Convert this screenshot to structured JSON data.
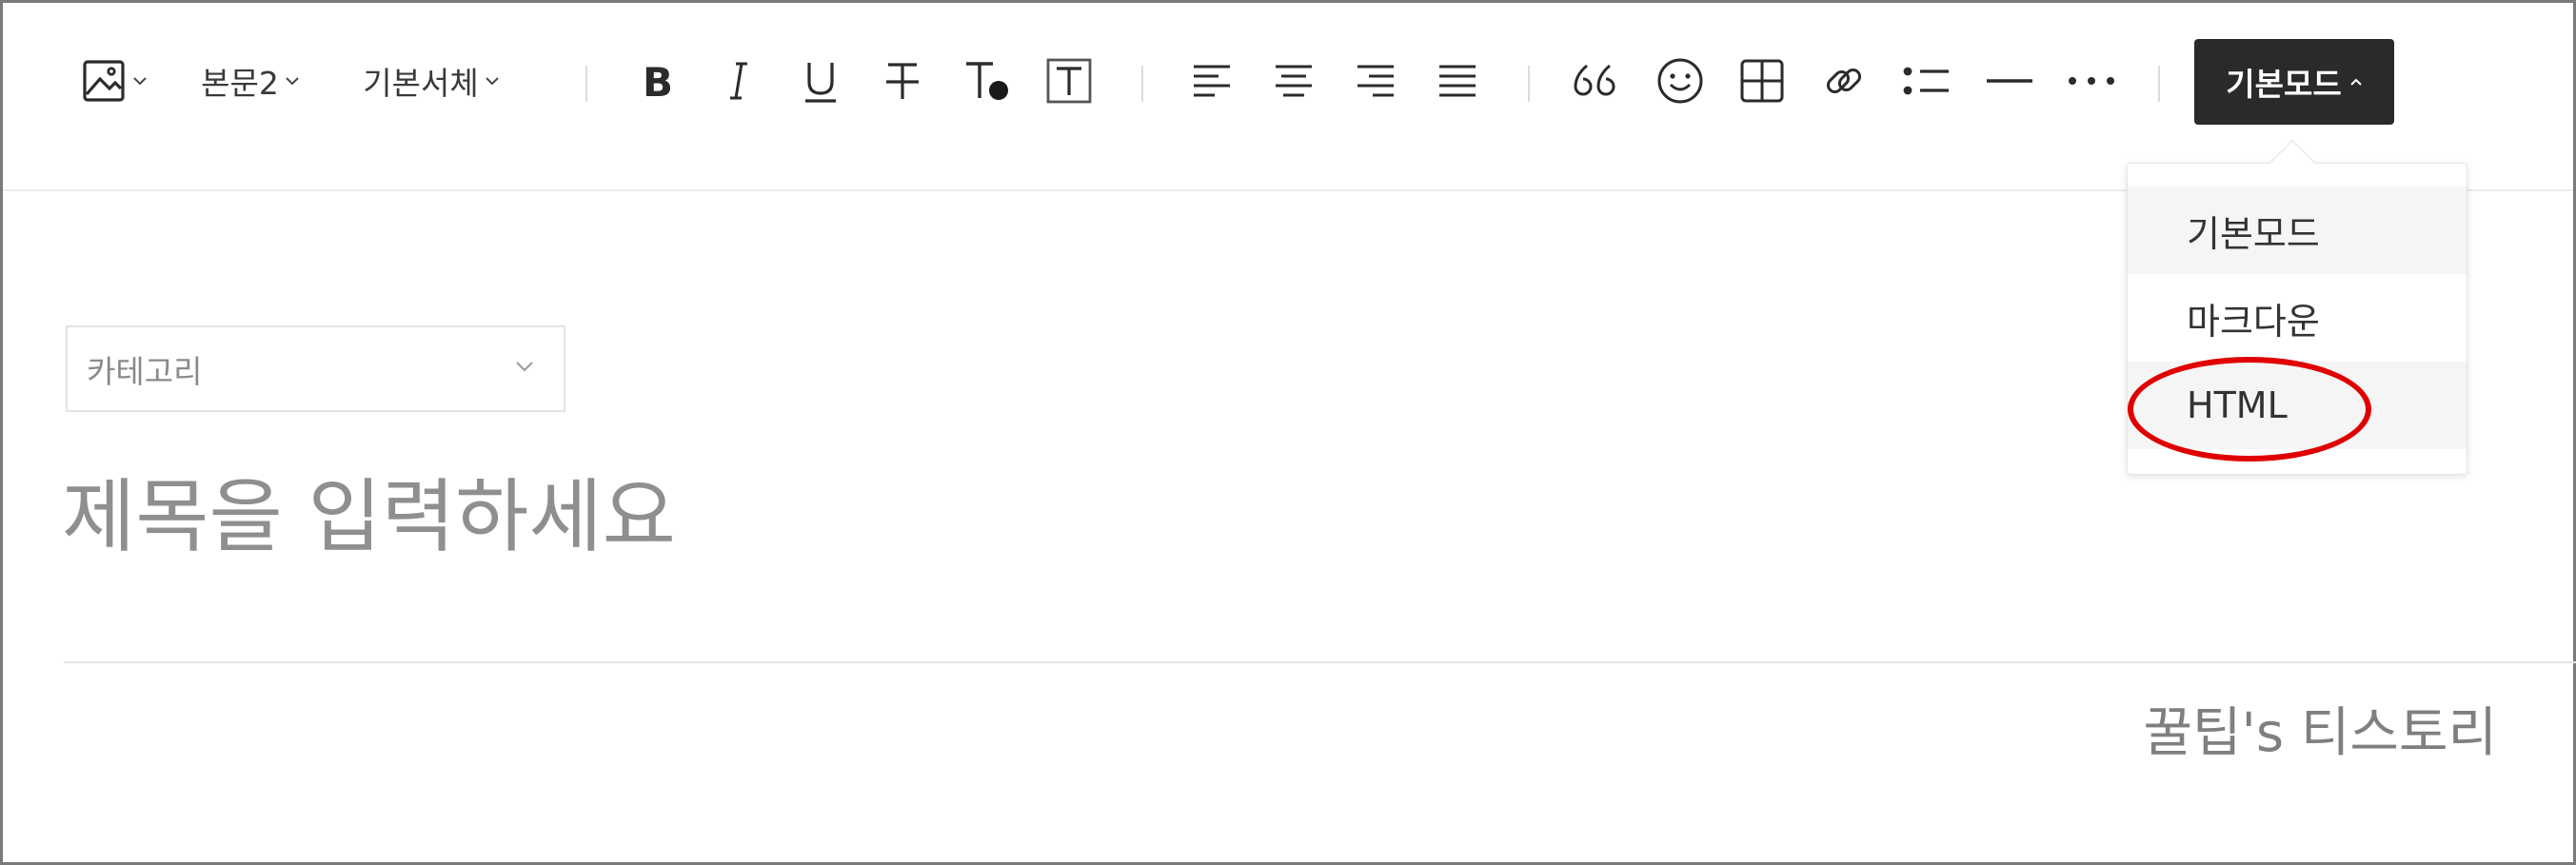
{
  "toolbar": {
    "paragraph_style": "본문2",
    "font_family": "기본서체",
    "mode_button_label": "기본모드",
    "mode_button_caret": "^",
    "icons": [
      "image-icon",
      "bold-icon",
      "italic-icon",
      "underline-icon",
      "strikethrough-icon",
      "text-color-icon",
      "text-background-icon",
      "align-left-icon",
      "align-center-icon",
      "align-right-icon",
      "align-justify-icon",
      "quote-icon",
      "emoji-icon",
      "table-icon",
      "link-icon",
      "list-icon",
      "horizontal-rule-icon",
      "more-icon"
    ]
  },
  "mode_dropdown": {
    "items": [
      {
        "label": "기본모드"
      },
      {
        "label": "마크다운"
      },
      {
        "label": "HTML"
      }
    ],
    "highlight_color": "#e00000"
  },
  "editor": {
    "category_placeholder": "카테고리",
    "title_placeholder": "제목을 입력하세요",
    "blog_name": "꿀팁's 티스토리"
  }
}
